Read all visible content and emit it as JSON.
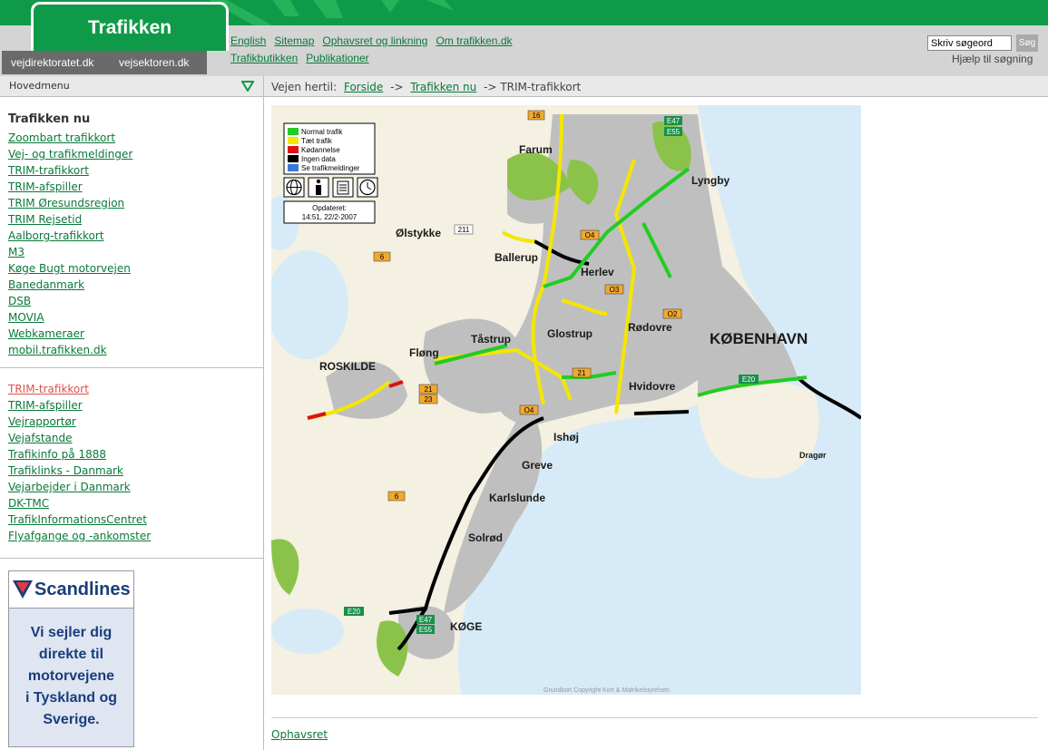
{
  "header": {
    "logo": "Trafikken",
    "sites": [
      "vejdirektoratet.dk",
      "vejsektoren.dk"
    ],
    "links_row1": [
      "English",
      "Sitemap",
      "Ophavsret og linkning",
      "Om trafikken.dk"
    ],
    "links_row2": [
      "Trafikbutikken",
      "Publikationer"
    ],
    "search_value": "Skriv søgeord",
    "search_button": "Søg",
    "search_help": "Hjælp til søgning"
  },
  "sidebar": {
    "menu_title": "Hovedmenu",
    "section_title": "Trafikken nu",
    "primary_links": [
      "Zoombart trafikkort",
      "Vej- og trafikmeldinger",
      "TRIM-trafikkort",
      "TRIM-afspiller",
      "TRIM Øresundsregion",
      "TRIM Rejsetid",
      "Aalborg-trafikkort",
      "M3",
      "Køge Bugt motorvejen",
      "Banedanmark",
      "DSB",
      "MOVIA",
      "Webkameraer",
      "mobil.trafikken.dk"
    ],
    "secondary_links": [
      "TRIM-trafikkort",
      "TRIM-afspiller",
      "Vejrapportør",
      "Vejafstande",
      "Trafikinfo på 1888",
      "Trafiklinks - Danmark",
      "Vejarbejder i Danmark",
      "DK-TMC",
      "TrafikInformationsCentret",
      "Flyafgange og -ankomster"
    ],
    "active_link_color": "#d9534f"
  },
  "ad": {
    "brand": "Scandlines",
    "lines": [
      "Vi sejler dig",
      "direkte til",
      "motorvejene",
      "i Tyskland og",
      "Sverige."
    ]
  },
  "breadcrumb": {
    "prefix": "Vejen hertil:",
    "home": "Forside",
    "sep1": "->",
    "parent": "Trafikken nu",
    "sep2": "->",
    "current": "TRIM-trafikkort"
  },
  "map": {
    "legend": [
      {
        "label": "Normal trafik",
        "color": "#22cc22"
      },
      {
        "label": "Tæt trafik",
        "color": "#f5e600"
      },
      {
        "label": "Kødannelse",
        "color": "#dd1111"
      },
      {
        "label": "Ingen data",
        "color": "#000000"
      },
      {
        "label": "Se trafikmeldinger",
        "color": "#3a78d6"
      }
    ],
    "updated_label": "Opdateret:",
    "updated_time": "14:51, 22/2-2007",
    "copyright": "Grundkort Copyright Kort & Matrikelstyrelsen",
    "places": [
      "Farum",
      "Lyngby",
      "Ølstykke",
      "Ballerup",
      "Herlev",
      "Rødovre",
      "KØBENHAVN",
      "Glostrup",
      "Tåstrup",
      "Fløng",
      "ROSKILDE",
      "Hvidovre",
      "Ishøj",
      "Greve",
      "Karlslunde",
      "Solrød",
      "KØGE",
      "Dragør"
    ],
    "road_numbers": [
      "16",
      "E47",
      "E55",
      "211",
      "O4",
      "6",
      "O3",
      "O2",
      "21",
      "23",
      "E20",
      "O4",
      "6",
      "E20",
      "E47",
      "E55",
      "21"
    ]
  },
  "footer": {
    "link": "Ophavsret"
  }
}
